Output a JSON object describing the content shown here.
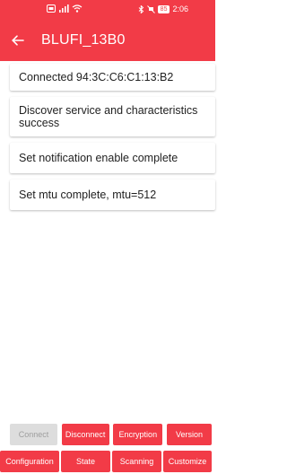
{
  "status_bar": {
    "time": "2:06",
    "battery": "85"
  },
  "app_bar": {
    "title": "BLUFI_13B0"
  },
  "log": [
    "Connected 94:3C:C6:C1:13:B2",
    "Discover service and characteristics success",
    "Set notification enable  complete",
    "Set mtu complete, mtu=512"
  ],
  "buttons_row1": [
    {
      "label": "Connect",
      "enabled": false
    },
    {
      "label": "Disconnect",
      "enabled": true
    },
    {
      "label": "Encryption",
      "enabled": true
    },
    {
      "label": "Version",
      "enabled": true
    }
  ],
  "buttons_row2": [
    {
      "label": "Configuration",
      "enabled": true
    },
    {
      "label": "State",
      "enabled": true
    },
    {
      "label": "Scanning",
      "enabled": true
    },
    {
      "label": "Customize",
      "enabled": true
    }
  ],
  "colors": {
    "accent": "#f23b47",
    "disabled_button": "#dddddd"
  }
}
